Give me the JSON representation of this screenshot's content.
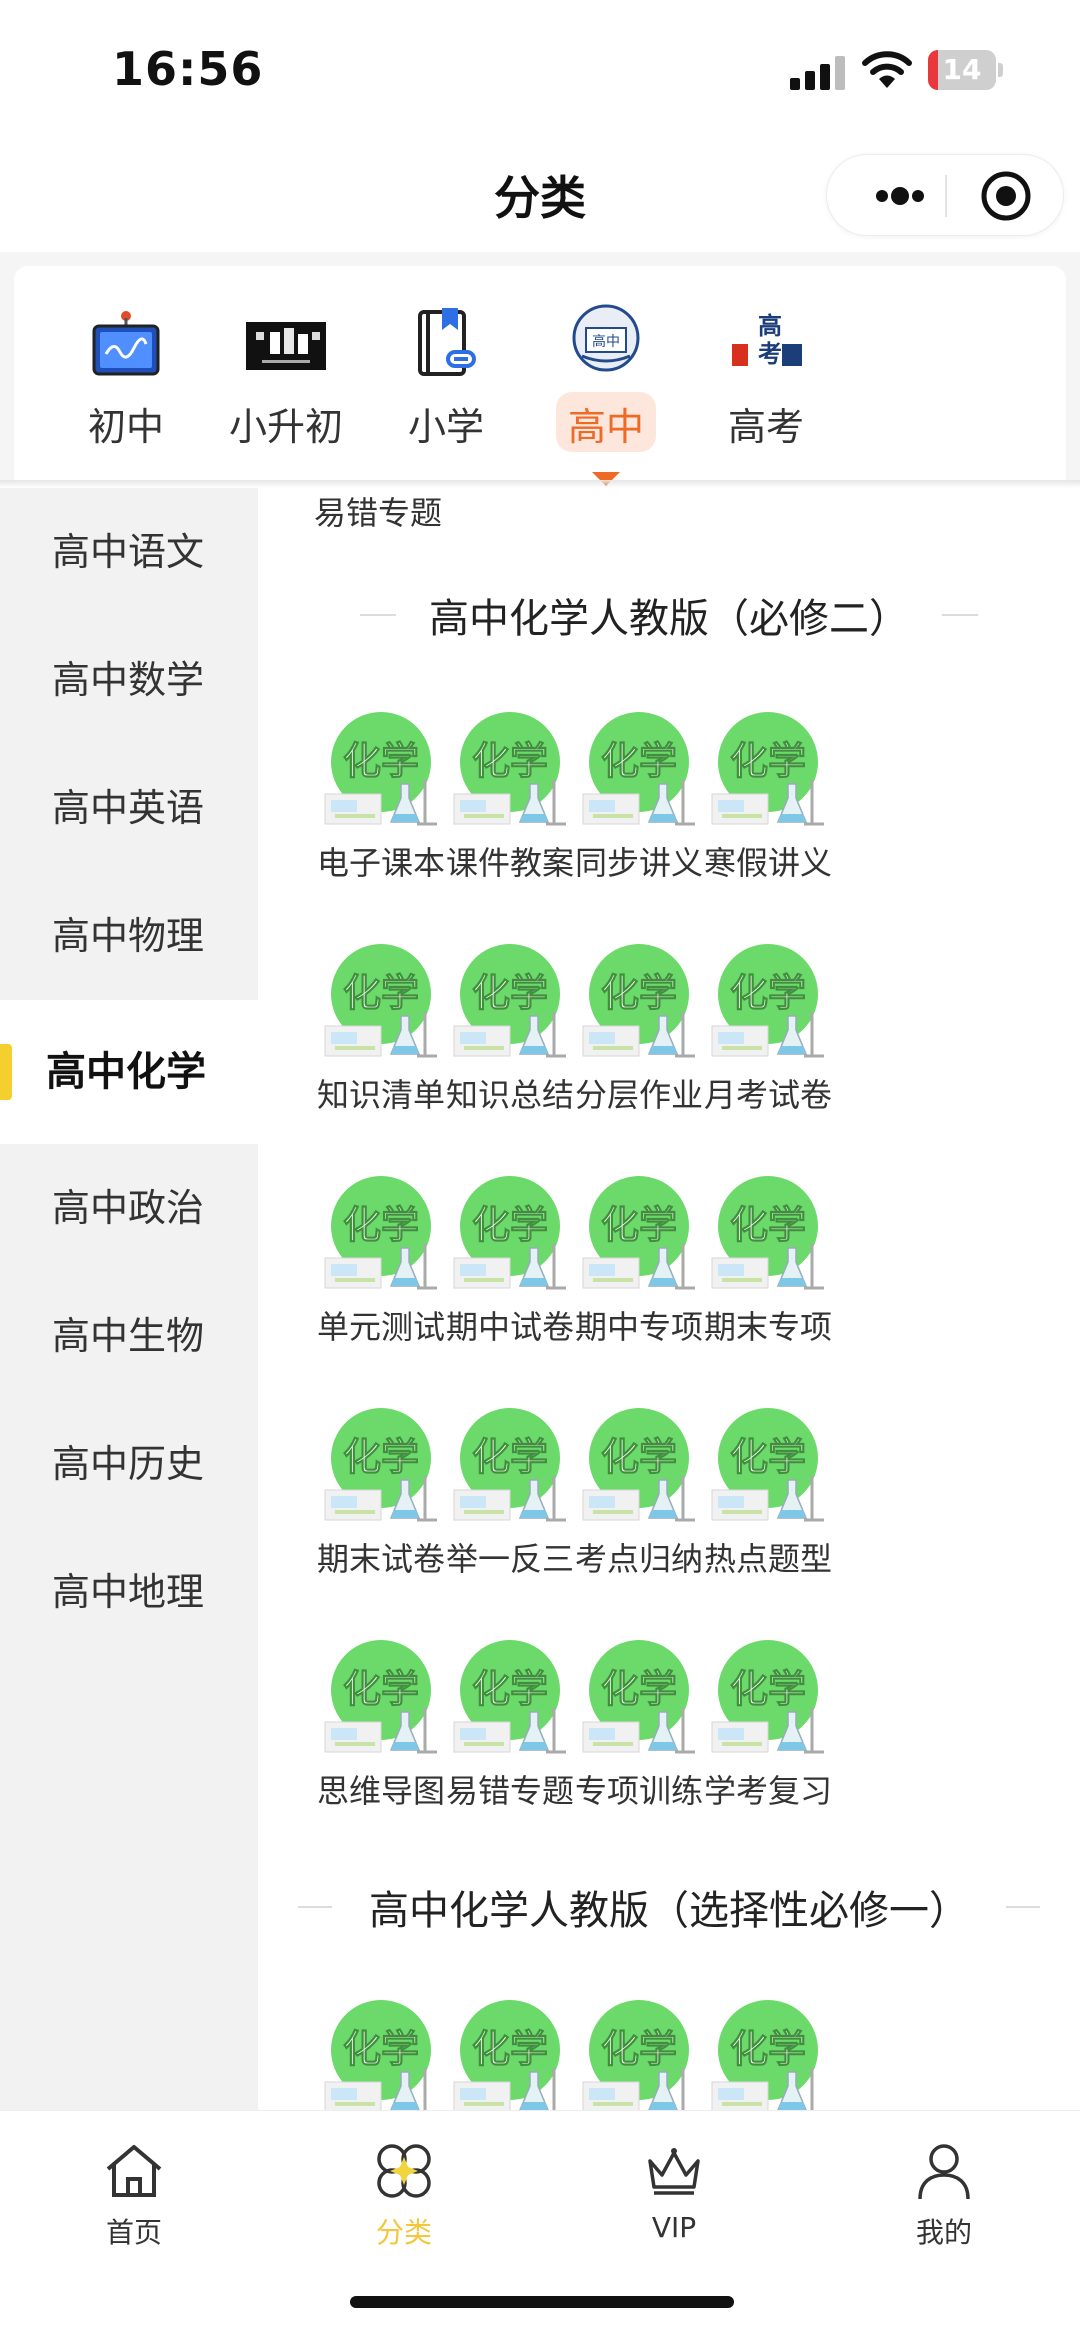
{
  "status": {
    "time": "16:56",
    "battery": "14",
    "battery_level": 0.14
  },
  "header": {
    "title": "分类"
  },
  "categories": [
    {
      "label": "初中",
      "icon": "whiteboard-icon",
      "active": false
    },
    {
      "label": "小升初",
      "icon": "presentation-image-icon",
      "active": false
    },
    {
      "label": "小学",
      "icon": "book-link-icon",
      "active": false
    },
    {
      "label": "高中",
      "icon": "high-school-badge-icon",
      "active": true
    },
    {
      "label": "高考",
      "icon": "gaokao-emblem-icon",
      "active": false
    }
  ],
  "sidebar": {
    "items": [
      {
        "label": "高中语文",
        "active": false
      },
      {
        "label": "高中数学",
        "active": false
      },
      {
        "label": "高中英语",
        "active": false
      },
      {
        "label": "高中物理",
        "active": false
      },
      {
        "label": "高中化学",
        "active": true
      },
      {
        "label": "高中政治",
        "active": false
      },
      {
        "label": "高中生物",
        "active": false
      },
      {
        "label": "高中历史",
        "active": false
      },
      {
        "label": "高中地理",
        "active": false
      }
    ]
  },
  "content": {
    "top_fragment": "易错专题",
    "tile_badge": "化学",
    "sections": [
      {
        "title": "高中化学人教版（必修二）",
        "items": [
          "电子课本",
          "课件教案",
          "同步讲义",
          "寒假讲义",
          "知识清单",
          "知识总结",
          "分层作业",
          "月考试卷",
          "单元测试",
          "期中试卷",
          "期中专项",
          "期末专项",
          "期末试卷",
          "举一反三",
          "考点归纳",
          "热点题型",
          "思维导图",
          "易错专题",
          "专项训练",
          "学考复习"
        ]
      },
      {
        "title": "高中化学人教版（选择性必修一）",
        "items": [
          "",
          "",
          "",
          ""
        ]
      }
    ]
  },
  "tabbar": {
    "tabs": [
      {
        "label": "首页",
        "icon": "home-icon",
        "active": false
      },
      {
        "label": "分类",
        "icon": "category-icon",
        "active": true
      },
      {
        "label": "VIP",
        "icon": "crown-icon",
        "active": false
      },
      {
        "label": "我的",
        "icon": "profile-icon",
        "active": false
      }
    ]
  },
  "colors": {
    "accent": "#ee6a27",
    "sidebar_indicator": "#f4cf2e",
    "tab_active": "#f3c73c",
    "chem_green": "#6cd96b"
  }
}
